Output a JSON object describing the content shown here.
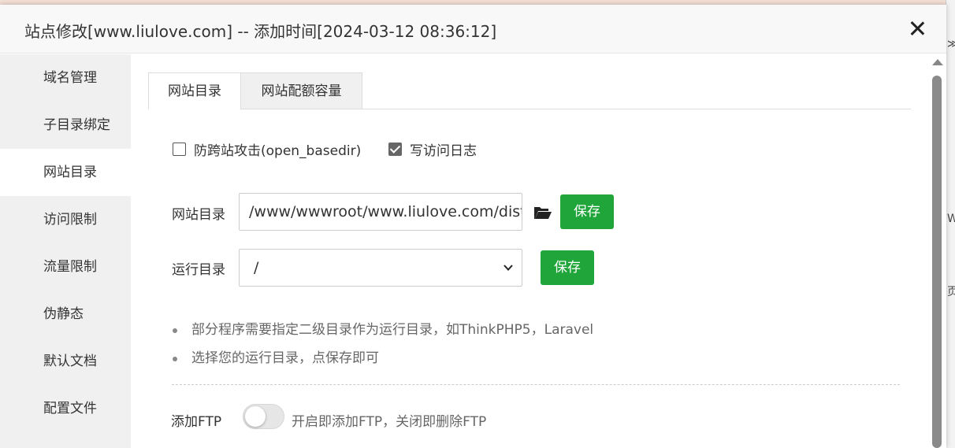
{
  "dialog": {
    "title": "站点修改[www.liulove.com] -- 添加时间[2024-03-12 08:36:12]"
  },
  "sidebar": {
    "items": [
      {
        "label": "域名管理"
      },
      {
        "label": "子目录绑定"
      },
      {
        "label": "网站目录"
      },
      {
        "label": "访问限制"
      },
      {
        "label": "流量限制"
      },
      {
        "label": "伪静态"
      },
      {
        "label": "默认文档"
      },
      {
        "label": "配置文件"
      }
    ],
    "active_index": 2
  },
  "tabs": [
    {
      "label": "网站目录"
    },
    {
      "label": "网站配额容量"
    }
  ],
  "options": {
    "open_basedir": {
      "label": "防跨站攻击(open_basedir)",
      "checked": false
    },
    "access_log": {
      "label": "写访问日志",
      "checked": true
    }
  },
  "site_dir": {
    "label": "网站目录",
    "value": "/www/wwwroot/www.liulove.com/dist",
    "save_label": "保存"
  },
  "run_dir": {
    "label": "运行目录",
    "value": "/",
    "save_label": "保存"
  },
  "tips": [
    {
      "text": "部分程序需要指定二级目录作为运行目录，如ThinkPHP5，Laravel"
    },
    {
      "text": "选择您的运行目录，点保存即可"
    }
  ],
  "ftp": {
    "label": "添加FTP",
    "enabled": false,
    "description": "开启即添加FTP，关闭即删除FTP"
  },
  "colors": {
    "accent_green": "#20a53a",
    "sidebar_bg": "#f0f0f0"
  },
  "icons": {
    "close": "close-icon",
    "folder": "folder-open-icon",
    "select_chevron": "chevron-down-icon",
    "scroll_up": "scroll-up-arrow-icon"
  },
  "background": {
    "fragments": [
      {
        "text": "≫"
      },
      {
        "text": "W"
      },
      {
        "text": "页"
      }
    ]
  }
}
